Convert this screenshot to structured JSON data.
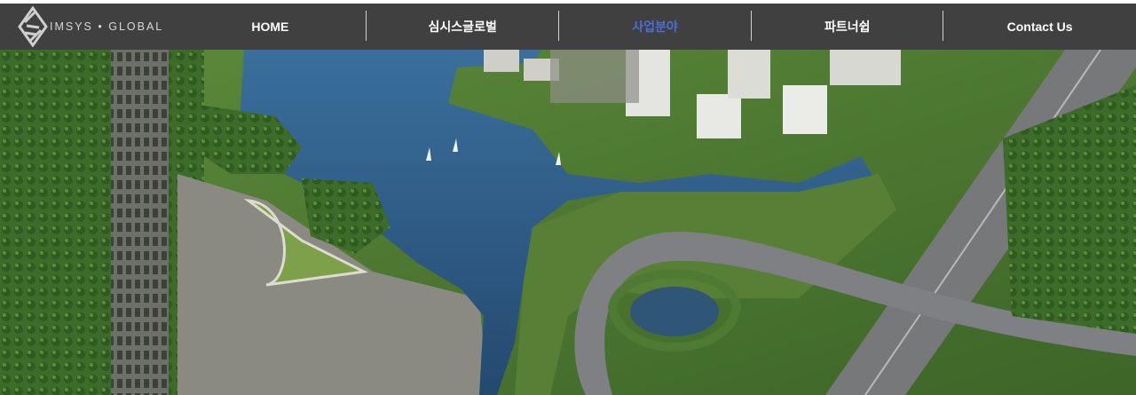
{
  "brand": {
    "name": "IMSYS • GLOBAL"
  },
  "nav": {
    "items": [
      {
        "label": "HOME",
        "active": false
      },
      {
        "label": "심시스글로벌",
        "active": false
      },
      {
        "label": "사업분야",
        "active": true
      },
      {
        "label": "파트너쉽",
        "active": false
      },
      {
        "label": "Contact Us",
        "active": false
      }
    ]
  },
  "colors": {
    "navbar_bg": "#404040",
    "nav_text": "#ffffff",
    "active_nav": "#4a6ed6",
    "water": "#2f5a86",
    "grass": "#4f7a33"
  },
  "hero": {
    "image": "aerial-rendering-lake-city-highway"
  }
}
